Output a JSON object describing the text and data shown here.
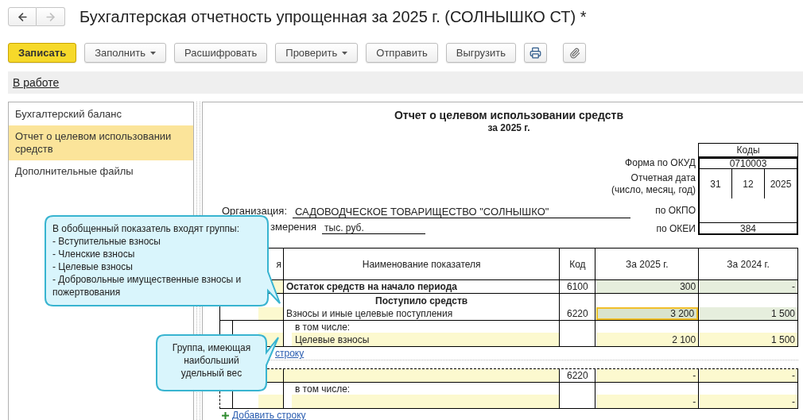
{
  "window": {
    "title": "Бухгалтерская отчетность упрощенная за 2025 г. (СОЛНЫШКО СТ) *"
  },
  "nav_buttons": [
    {
      "kind": "back",
      "disabled": false
    },
    {
      "kind": "forward",
      "disabled": true
    }
  ],
  "toolbar": [
    {
      "kind": "primary",
      "label": "Записать"
    },
    {
      "kind": "dropdown",
      "label": "Заполнить"
    },
    {
      "kind": "plain",
      "label": "Расшифровать"
    },
    {
      "kind": "dropdown",
      "label": "Проверить"
    },
    {
      "kind": "plain",
      "label": "Отправить"
    },
    {
      "kind": "plain",
      "label": "Выгрузить"
    },
    {
      "kind": "print"
    },
    {
      "kind": "attach"
    }
  ],
  "status_bar": {
    "link": "В работе"
  },
  "sidebar": {
    "items": [
      {
        "label": "Бухгалтерский баланс",
        "selected": false
      },
      {
        "label": "Отчет о целевом использовании средств",
        "selected": true
      },
      {
        "label": "Дополнительные файлы",
        "selected": false
      }
    ]
  },
  "report": {
    "title": "Отчет о целевом использовании средств",
    "subtitle": "за 2025 г.",
    "codes": {
      "header": "Коды",
      "rows": [
        {
          "label": "Форма по ОКУД",
          "values": [
            "0710003"
          ]
        },
        {
          "label": "Отчетная дата\n(число, месяц, год)",
          "values": [
            "31",
            "12",
            "2025"
          ]
        },
        {
          "label": "по ОКПО",
          "values": []
        },
        {
          "label": "по ОКЕИ",
          "values": [
            "384"
          ]
        }
      ]
    },
    "organization": {
      "label": "Организация:",
      "value": "САДОВОДЧЕСКОЕ ТОВАРИЩЕСТВО \"СОЛНЫШКО\""
    },
    "units": {
      "label": "змерения",
      "value": "тыс. руб."
    },
    "table": {
      "columns": [
        "я",
        "Наименование показателя",
        "Код",
        "За 2025 г.",
        "За 2024 г."
      ],
      "sections": [
        {
          "rows": [
            {
              "kind": "line",
              "name": "Остаток средств на начало периода",
              "bold": true,
              "editable": false,
              "code": "6100",
              "values": [
                {
                  "text": "300",
                  "selected": false
                },
                {
                  "text": "-",
                  "selected": false
                }
              ]
            },
            {
              "kind": "heading",
              "name": "Поступило средств"
            },
            {
              "kind": "line",
              "name": "Взносы и иные целевые поступления",
              "bold": false,
              "editable": false,
              "code": "6220",
              "values": [
                {
                  "text": "3 200",
                  "selected": true
                },
                {
                  "text": "1 500",
                  "selected": false
                }
              ]
            },
            {
              "kind": "note",
              "name": "в том числе:"
            },
            {
              "kind": "group",
              "name": "Целевые взносы",
              "values": [
                {
                  "text": "2 100",
                  "selected": false
                },
                {
                  "text": "1 500",
                  "selected": false
                }
              ]
            }
          ],
          "add_link": {
            "text": "строку",
            "icon": false
          }
        },
        {
          "rows": [
            {
              "kind": "line",
              "editable": true,
              "code": "6220",
              "values": [
                {
                  "text": "-",
                  "selected": false
                },
                {
                  "text": "-",
                  "selected": false
                }
              ]
            },
            {
              "kind": "note",
              "name": "в том числе:"
            },
            {
              "kind": "group",
              "values": [
                {
                  "text": "-",
                  "selected": false
                },
                {
                  "text": "-",
                  "selected": false
                }
              ]
            }
          ],
          "add_link": {
            "text": "Добавить строку",
            "icon": true
          }
        }
      ]
    }
  },
  "callouts": [
    {
      "kind": "list",
      "lines": [
        "В обобщенный показатель входят группы:",
        "- Вступительные взносы",
        "- Членские взносы",
        "- Целевые взносы",
        "- Добровольные имущественные взносы и",
        "пожертвования"
      ]
    },
    {
      "kind": "centered",
      "lines": [
        "Группа, имеющая",
        "наибольший",
        "удельный вес"
      ]
    }
  ]
}
